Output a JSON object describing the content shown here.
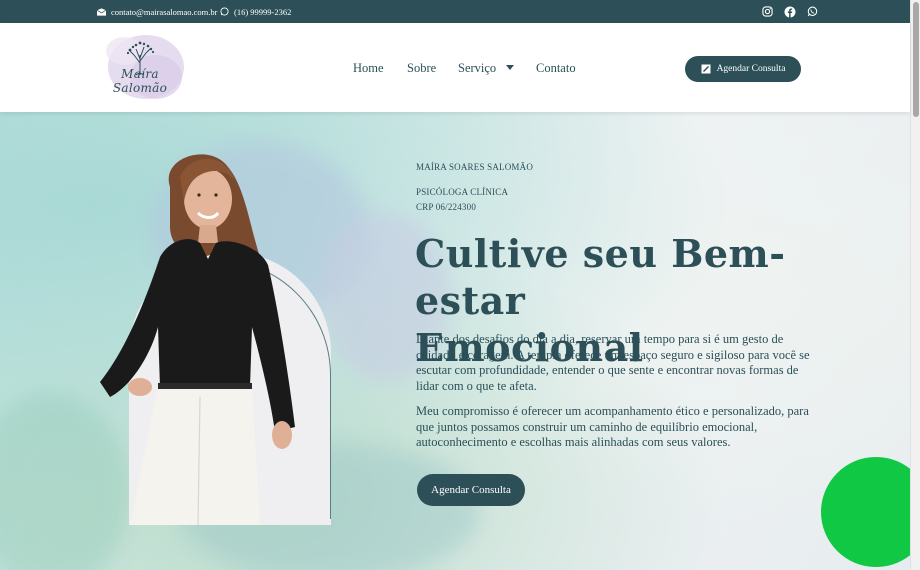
{
  "topbar": {
    "email": "contato@mairasalomao.com.br",
    "phone": "(16) 99999-2362",
    "socials": [
      "instagram-icon",
      "facebook-icon",
      "whatsapp-icon"
    ]
  },
  "header": {
    "logo_text": "Maíra Salomão",
    "nav": {
      "home": "Home",
      "sobre": "Sobre",
      "servico": "Serviço",
      "contato": "Contato"
    },
    "cta": "Agendar Consulta"
  },
  "hero": {
    "name": "MAÍRA SOARES SALOMÃO",
    "role": "PSICÓLOGA CLÍNICA",
    "crp": "CRP 06/224300",
    "headline_line1": "Cultive seu Bem-estar",
    "headline_line2": "Emocional",
    "paragraph1": "Diante dos desafios do dia a dia, reservar um tempo para si é um gesto de cuidado e coragem. A terapia oferece um espaço seguro e sigiloso para você se escutar com profundidade, entender o que sente e encontrar novas formas de lidar com o que te afeta.",
    "paragraph2": "Meu compromisso é oferecer um acompanhamento ético e personalizado, para que juntos possamos construir um caminho de equilíbrio emocional, autoconhecimento e escolhas mais alinhadas com seus valores.",
    "cta": "Agendar Consulta"
  },
  "colors": {
    "brand": "#2c4f58",
    "whatsapp_float": "#10c844"
  }
}
